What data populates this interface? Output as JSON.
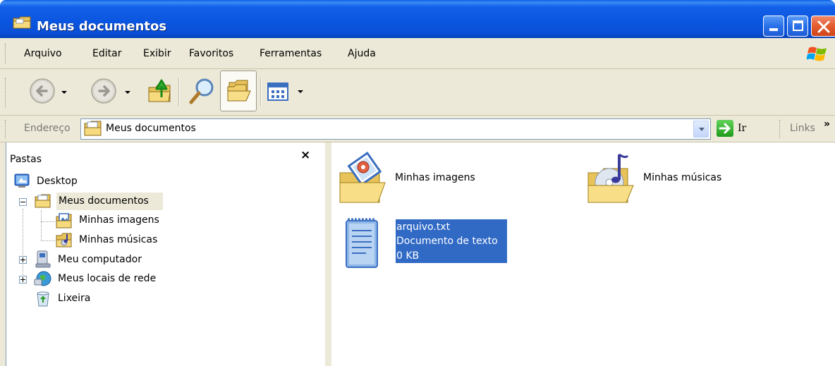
{
  "window": {
    "title": "Meus documentos"
  },
  "menu": {
    "items": [
      {
        "label": "Arquivo"
      },
      {
        "label": "Editar"
      },
      {
        "label": "Exibir"
      },
      {
        "label": "Favoritos"
      },
      {
        "label": "Ferramentas"
      },
      {
        "label": "Ajuda"
      }
    ]
  },
  "toolbar": {
    "buttons": [
      "back-icon",
      "forward-icon",
      "up-folder-icon",
      "search-icon",
      "folders-icon",
      "views-icon"
    ]
  },
  "address": {
    "label": "Endereço",
    "value": "Meus documentos",
    "go_label": "Ir",
    "links_label": "Links",
    "links_chevron": "»"
  },
  "folders_pane": {
    "title": "Pastas",
    "close_glyph": "×",
    "tree": [
      {
        "label": "Desktop",
        "icon": "desktop-icon"
      },
      {
        "label": "Meus documentos",
        "icon": "my-documents-icon",
        "expanded": true,
        "selected": true
      },
      {
        "label": "Minhas imagens",
        "icon": "my-pictures-icon"
      },
      {
        "label": "Minhas músicas",
        "icon": "my-music-icon"
      },
      {
        "label": "Meu computador",
        "icon": "my-computer-icon",
        "expandable": true
      },
      {
        "label": "Meus locais de rede",
        "icon": "network-places-icon",
        "expandable": true
      },
      {
        "label": "Lixeira",
        "icon": "recycle-bin-icon"
      }
    ]
  },
  "content": {
    "items": [
      {
        "name": "Minhas imagens",
        "icon": "pictures-folder-icon"
      },
      {
        "name": "Minhas músicas",
        "icon": "music-folder-icon"
      },
      {
        "name": "arquivo.txt",
        "type": "Documento de texto",
        "size": "0 KB",
        "icon": "text-document-icon",
        "selected": true
      }
    ]
  },
  "colors": {
    "title_bar": "#0a55df",
    "chrome": "#ece9d8",
    "selection": "#316ac5",
    "close_button": "#e35b30"
  }
}
